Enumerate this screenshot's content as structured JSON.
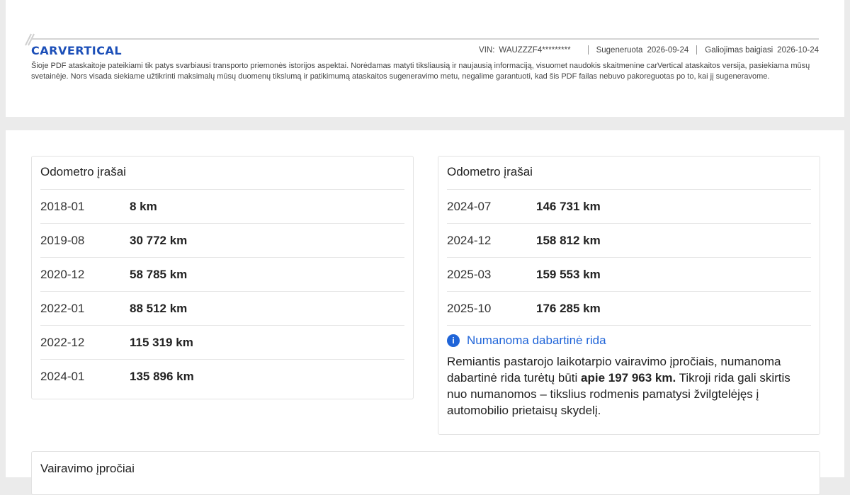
{
  "header": {
    "brand": "CARVERTICAL",
    "vin_label": "VIN:",
    "vin_value": "WAUZZZF4*********",
    "generated_label": "Sugeneruota",
    "generated_date": "2026-09-24",
    "valid_label": "Galiojimas baigiasi",
    "valid_date": "2026-10-24",
    "disclaimer": "Šioje PDF ataskaitoje pateikiami tik patys svarbiausi transporto priemonės istorijos aspektai. Norėdamas matyti tiksliausią ir naujausią informaciją, visuomet naudokis skaitmenine carVertical ataskaitos versija, pasiekiama mūsų svetainėje. Nors visada siekiame užtikrinti maksimalų mūsų duomenų tikslumą ir patikimumą ataskaitos sugeneravimo metu, negalime garantuoti, kad šis PDF failas nebuvo pakoreguotas po to, kai jį sugeneravome."
  },
  "odometer_left": {
    "title": "Odometro įrašai",
    "rows": [
      {
        "date": "2018-01",
        "km": "8 km"
      },
      {
        "date": "2019-08",
        "km": "30 772 km"
      },
      {
        "date": "2020-12",
        "km": "58 785 km"
      },
      {
        "date": "2022-01",
        "km": "88 512 km"
      },
      {
        "date": "2022-12",
        "km": "115 319 km"
      },
      {
        "date": "2024-01",
        "km": "135 896 km"
      }
    ]
  },
  "odometer_right": {
    "title": "Odometro įrašai",
    "rows": [
      {
        "date": "2024-07",
        "km": "146 731 km"
      },
      {
        "date": "2024-12",
        "km": "158 812 km"
      },
      {
        "date": "2025-03",
        "km": "159 553 km"
      },
      {
        "date": "2025-10",
        "km": "176 285 km"
      }
    ],
    "estimate": {
      "icon": "i",
      "title": "Numanoma dabartinė rida",
      "text_before": "Remiantis pastarojo laikotarpio vairavimo įpročiais, numanoma dabartinė rida turėtų būti ",
      "text_bold": "apie 197 963 km.",
      "text_after": " Tikroji rida gali skirtis nuo numanomos – tikslius rodmenis pamatysi žvilgtelėjęs į automobilio prietaisų skydelį."
    }
  },
  "driving_habits": {
    "title": "Vairavimo įpročiai"
  },
  "colors": {
    "brand_blue": "#1c4fb8",
    "info_blue": "#1f64d8"
  }
}
